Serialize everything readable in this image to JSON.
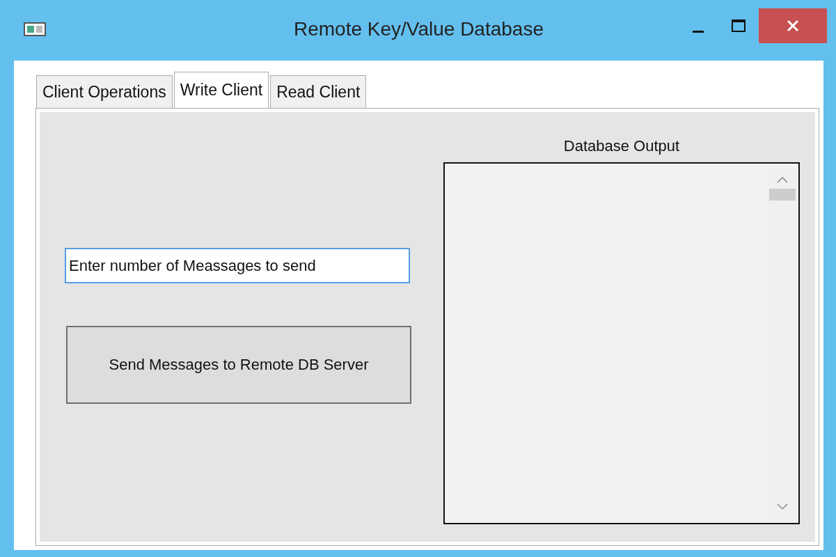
{
  "window": {
    "title": "Remote Key/Value Database"
  },
  "tabs": [
    {
      "label": "Client Operations",
      "selected": false
    },
    {
      "label": "Write Client",
      "selected": true
    },
    {
      "label": "Read Client",
      "selected": false
    }
  ],
  "message_count_field": {
    "value": "Enter number of Meassages to send"
  },
  "send_button": {
    "label": "Send Messages to Remote DB Server"
  },
  "output": {
    "label": "Database Output"
  }
}
